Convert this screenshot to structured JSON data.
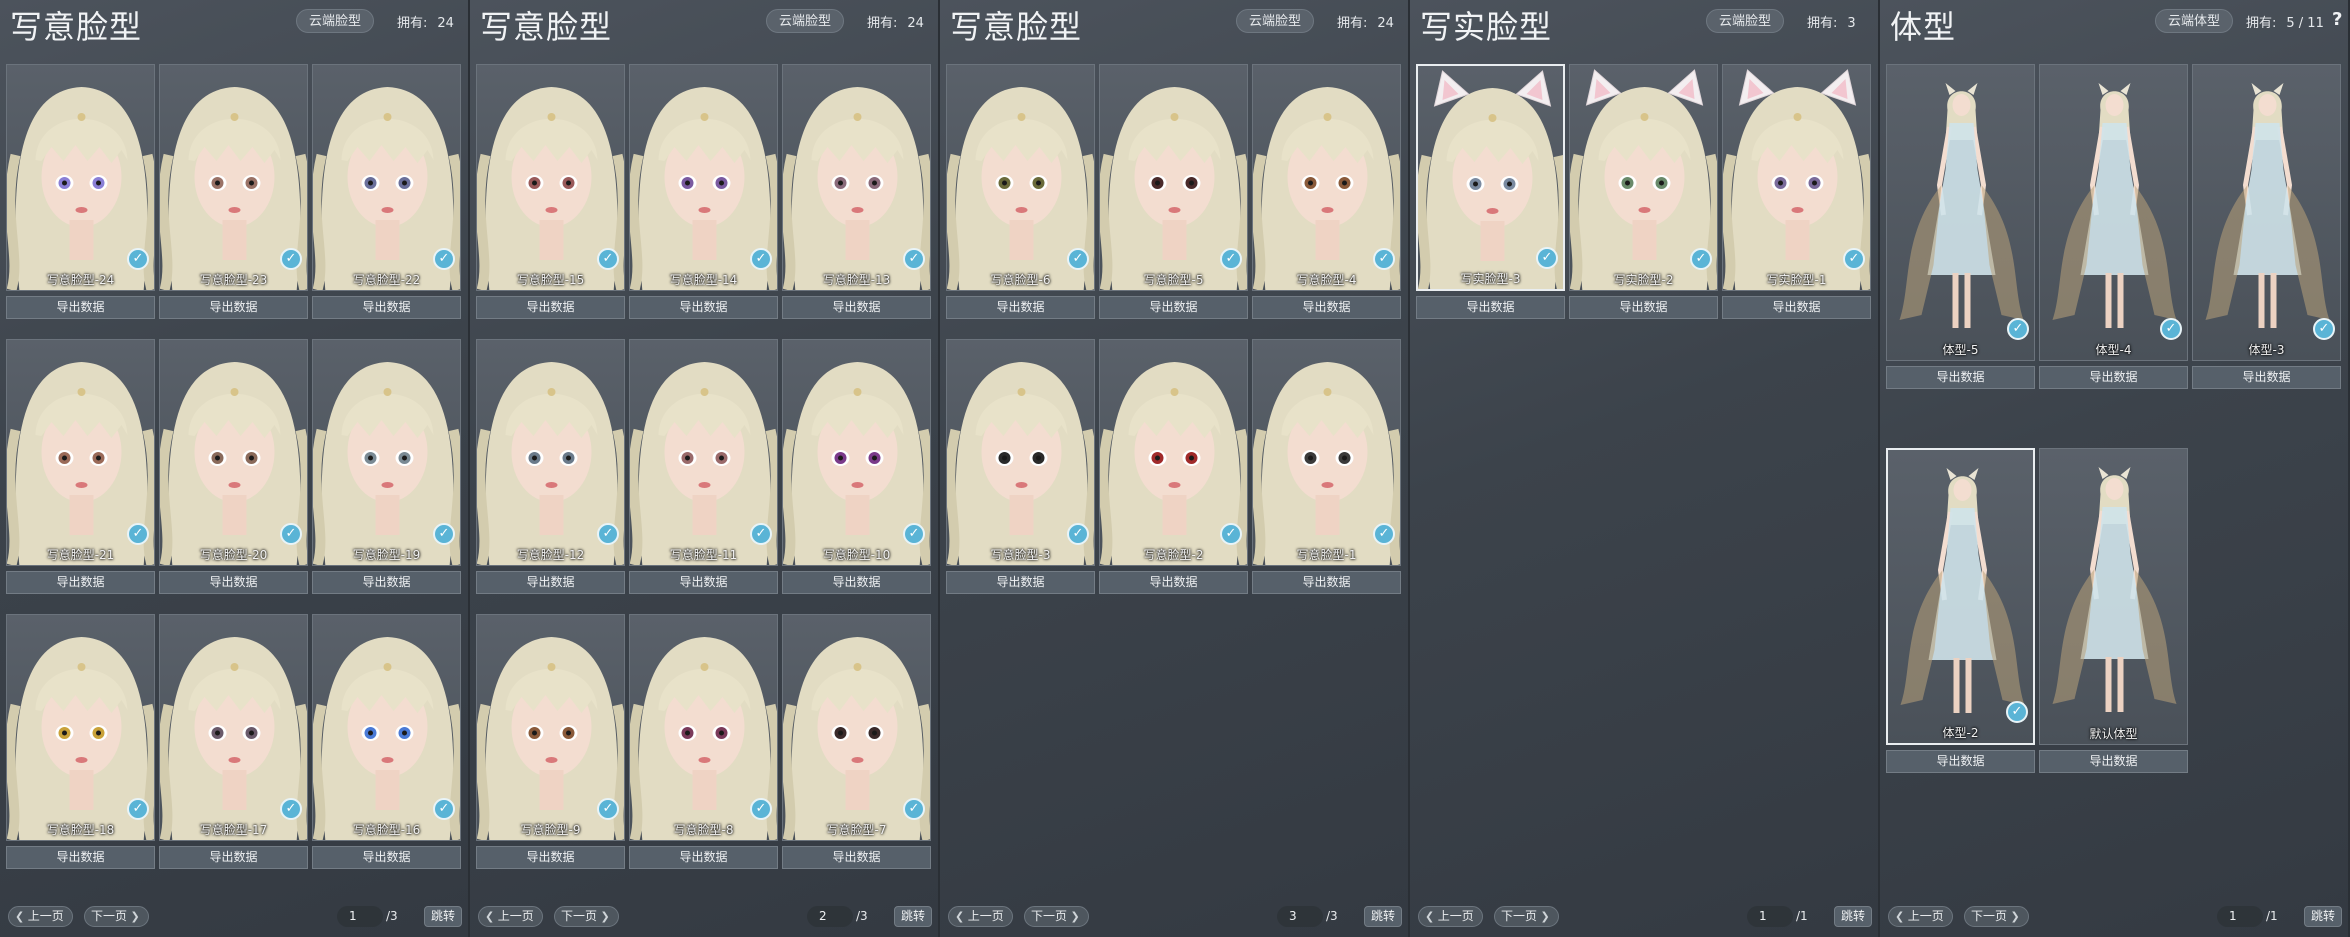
{
  "panels": [
    {
      "title": "写意脸型",
      "cloud_label": "云端脸型",
      "owned_label": "拥有:",
      "owned_count": "24",
      "cards": [
        {
          "label": "写意脸型-24",
          "export": "导出数据",
          "checked": true,
          "eye": "#8a7fd6"
        },
        {
          "label": "写意脸型-23",
          "export": "导出数据",
          "checked": true,
          "eye": "#9a7266"
        },
        {
          "label": "写意脸型-22",
          "export": "导出数据",
          "checked": true,
          "eye": "#6a6f9a"
        },
        {
          "label": "写意脸型-21",
          "export": "导出数据",
          "checked": true,
          "eye": "#9a6a58"
        },
        {
          "label": "写意脸型-20",
          "export": "导出数据",
          "checked": true,
          "eye": "#8a6a5a"
        },
        {
          "label": "写意脸型-19",
          "export": "导出数据",
          "checked": true,
          "eye": "#7a8a94"
        },
        {
          "label": "写意脸型-18",
          "export": "导出数据",
          "checked": true,
          "eye": "#c9a23a"
        },
        {
          "label": "写意脸型-17",
          "export": "导出数据",
          "checked": true,
          "eye": "#6a5a6a"
        },
        {
          "label": "写意脸型-16",
          "export": "导出数据",
          "checked": true,
          "eye": "#4a7ad6"
        }
      ],
      "pager": {
        "prev": "上一页",
        "next": "下一页",
        "page": "1",
        "total": "/3",
        "jump": "跳转"
      }
    },
    {
      "title": "写意脸型",
      "cloud_label": "云端脸型",
      "owned_label": "拥有:",
      "owned_count": "24",
      "cards": [
        {
          "label": "写意脸型-15",
          "export": "导出数据",
          "checked": true,
          "eye": "#9a5a5a"
        },
        {
          "label": "写意脸型-14",
          "export": "导出数据",
          "checked": true,
          "eye": "#7a5aa0"
        },
        {
          "label": "写意脸型-13",
          "export": "导出数据",
          "checked": true,
          "eye": "#8a6a7a"
        },
        {
          "label": "写意脸型-12",
          "export": "导出数据",
          "checked": true,
          "eye": "#6a7a8a"
        },
        {
          "label": "写意脸型-11",
          "export": "导出数据",
          "checked": true,
          "eye": "#9a6a6a"
        },
        {
          "label": "写意脸型-10",
          "export": "导出数据",
          "checked": true,
          "eye": "#7a3a8a"
        },
        {
          "label": "写意脸型-9",
          "export": "导出数据",
          "checked": true,
          "eye": "#8a5a3a"
        },
        {
          "label": "写意脸型-8",
          "export": "导出数据",
          "checked": true,
          "eye": "#7a3a5a"
        },
        {
          "label": "写意脸型-7",
          "export": "导出数据",
          "checked": true,
          "eye": "#3a2a2a"
        }
      ],
      "pager": {
        "prev": "上一页",
        "next": "下一页",
        "page": "2",
        "total": "/3",
        "jump": "跳转"
      }
    },
    {
      "title": "写意脸型",
      "cloud_label": "云端脸型",
      "owned_label": "拥有:",
      "owned_count": "24",
      "cards": [
        {
          "label": "写意脸型-6",
          "export": "导出数据",
          "checked": true,
          "eye": "#6a6a3a"
        },
        {
          "label": "写意脸型-5",
          "export": "导出数据",
          "checked": true,
          "eye": "#4a2a2a"
        },
        {
          "label": "写意脸型-4",
          "export": "导出数据",
          "checked": true,
          "eye": "#8a5a3a"
        },
        {
          "label": "写意脸型-3",
          "export": "导出数据",
          "checked": true,
          "eye": "#2a2a2a"
        },
        {
          "label": "写意脸型-2",
          "export": "导出数据",
          "checked": true,
          "eye": "#a02a2a"
        },
        {
          "label": "写意脸型-1",
          "export": "导出数据",
          "checked": true,
          "eye": "#3a3a3a"
        }
      ],
      "pager": {
        "prev": "上一页",
        "next": "下一页",
        "page": "3",
        "total": "/3",
        "jump": "跳转"
      }
    },
    {
      "title": "写实脸型",
      "cloud_label": "云端脸型",
      "owned_label": "拥有:",
      "owned_count": "3",
      "cards": [
        {
          "label": "写实脸型-3",
          "export": "导出数据",
          "checked": true,
          "eye": "#7a8aa0",
          "ears": true,
          "selected": true
        },
        {
          "label": "写实脸型-2",
          "export": "导出数据",
          "checked": true,
          "eye": "#6a8a6a",
          "ears": true
        },
        {
          "label": "写实脸型-1",
          "export": "导出数据",
          "checked": true,
          "eye": "#7a6a9a",
          "ears": true
        }
      ],
      "pager": {
        "prev": "上一页",
        "next": "下一页",
        "page": "1",
        "total": "/1",
        "jump": "跳转"
      }
    },
    {
      "title": "体型",
      "cloud_label": "云端体型",
      "owned_label": "拥有:",
      "owned_count": "5 / 11",
      "help": "?",
      "cards": [
        {
          "label": "体型-5",
          "export": "导出数据",
          "checked": true
        },
        {
          "label": "体型-4",
          "export": "导出数据",
          "checked": true
        },
        {
          "label": "体型-3",
          "export": "导出数据",
          "checked": true
        },
        {
          "label": "体型-2",
          "export": "导出数据",
          "checked": true,
          "selected": true
        },
        {
          "label": "默认体型",
          "export": "导出数据",
          "checked": false
        }
      ],
      "pager": {
        "prev": "上一页",
        "next": "下一页",
        "page": "1",
        "total": "/1",
        "jump": "跳转"
      }
    }
  ],
  "colors": {
    "check": "#5ab4d6",
    "hair": "#e2dcc3",
    "skin": "#f3ddd0",
    "dress": "#cfe3ea"
  }
}
